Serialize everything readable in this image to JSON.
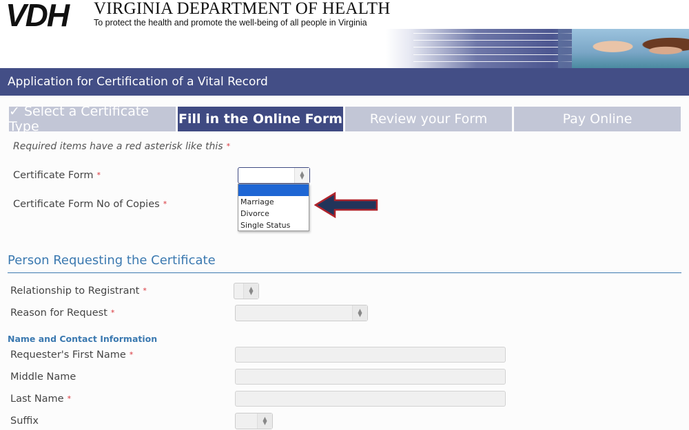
{
  "header": {
    "logo": "VDH",
    "org_name": "VIRGINIA DEPARTMENT OF HEALTH",
    "tagline": "To protect the health and promote the well-being of all people in Virginia"
  },
  "title_bar": {
    "title": "Application for Certification of a Vital Record"
  },
  "steps": [
    {
      "label": "✓ Select a Certificate Type",
      "state": "completed"
    },
    {
      "label": "Fill in the Online Form",
      "state": "active"
    },
    {
      "label": "Review your Form",
      "state": "pending"
    },
    {
      "label": "Pay Online",
      "state": "pending"
    }
  ],
  "required_note": "Required items have a red asterisk like this",
  "asterisk": "*",
  "certificate": {
    "form_label": "Certificate Form",
    "form_value": "",
    "copies_label": "Certificate Form No of Copies",
    "dropdown_options": [
      "",
      "Marriage",
      "Divorce",
      "Single Status"
    ],
    "dropdown_selected_index": 0
  },
  "person_section": {
    "title": "Person Requesting the Certificate",
    "relationship_label": "Relationship to Registrant",
    "reason_label": "Reason for Request",
    "contact_subtitle": "Name and Contact Information",
    "first_name_label": "Requester's First Name",
    "middle_name_label": "Middle Name",
    "last_name_label": "Last Name",
    "suffix_label": "Suffix"
  },
  "colors": {
    "brand_navy": "#434e86",
    "step_active": "#3f4a82",
    "step_inactive": "#c2c6d6",
    "section_blue": "#3b79b0",
    "asterisk_red": "#d9343a",
    "dropdown_highlight": "#1e66d4"
  }
}
